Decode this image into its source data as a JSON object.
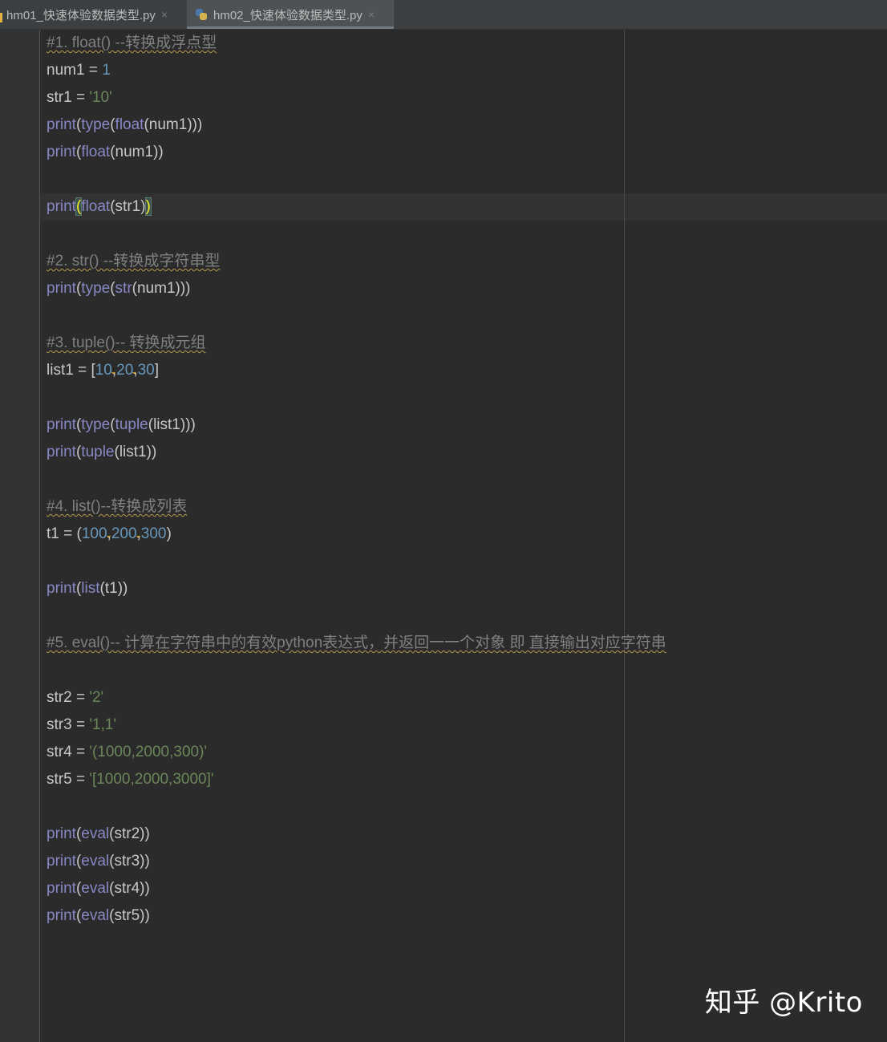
{
  "tabs": [
    {
      "label": "hm01_快速体验数据类型.py",
      "close": "×",
      "modified": true
    },
    {
      "label": "hm02_快速体验数据类型.py",
      "close": "×",
      "active": true,
      "icon": "python-file-icon"
    }
  ],
  "code_lines": [
    "#1. float() --转换成浮点型",
    "num1 = 1",
    "str1 = '10'",
    "print(type(float(num1)))",
    "print(float(num1))",
    "",
    "print(float(str1))",
    "",
    "#2. str() --转换成字符串型",
    "print(type(str(num1)))",
    "",
    "#3. tuple()-- 转换成元组",
    "list1 = [10,20,30]",
    "",
    "print(type(tuple(list1)))",
    "print(tuple(list1))",
    "",
    "#4. list()--转换成列表",
    "t1 = (100,200,300)",
    "",
    "print(list(t1))",
    "",
    "#5. eval()-- 计算在字符串中的有效python表达式，并返回一一个对象 即 直接输出对应字符串",
    "",
    "str2 = '2'",
    "str3 = '1,1'",
    "str4 = '(1000,2000,300)'",
    "str5 = '[1000,2000,3000]'",
    "",
    "print(eval(str2))",
    "print(eval(str3))",
    "print(eval(str4))",
    "print(eval(str5))"
  ],
  "syntax_colors": {
    "background": "#2b2b2b",
    "builtin": "#8888c6",
    "number": "#6897bb",
    "string": "#6a8759",
    "comment": "#808080",
    "default": "#c8c8c8",
    "bracket_match": "#ffef28"
  },
  "watermark": "知乎 @Krito"
}
